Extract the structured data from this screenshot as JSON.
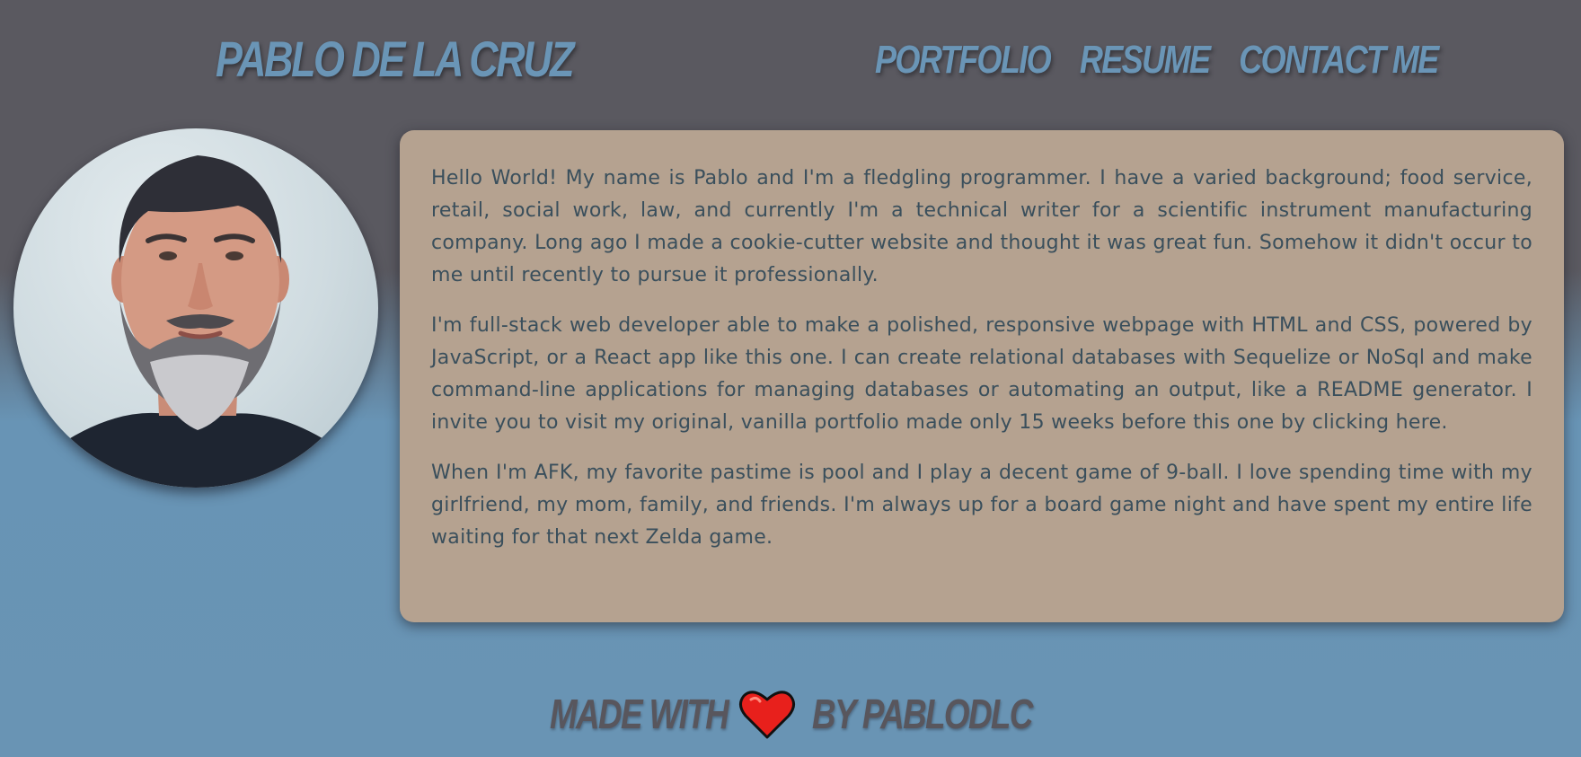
{
  "header": {
    "brand": "Pablo De La Cruz",
    "nav": [
      {
        "label": "Portfolio"
      },
      {
        "label": "Resume"
      },
      {
        "label": "Contact Me"
      }
    ]
  },
  "about": {
    "paragraphs": [
      "Hello World! My name is Pablo and I'm a fledgling programmer. I have a varied background; food service, retail, social work, law, and currently I'm a technical writer for a scientific instrument manufacturing company. Long ago I made a cookie-cutter website and thought it was great fun. Somehow it didn't occur to me until recently to pursue it professionally.",
      "I'm full-stack web developer able to make a polished, responsive webpage with HTML and CSS, powered by JavaScript, or a React app like this one. I can create relational databases with Sequelize or NoSql and make command-line applications for managing databases or automating an output, like a README generator. I invite you to visit my original, vanilla portfolio made only 15 weeks before this one by clicking here.",
      "When I'm AFK, my favorite pastime is pool and I play a decent game of 9-ball. I love spending time with my girlfriend, my mom, family, and friends. I'm always up for a board game night and have spent my entire life waiting for that next Zelda game."
    ]
  },
  "footer": {
    "made_with": "Made With",
    "by": "By PabloDLC",
    "icon": "heart-icon"
  },
  "colors": {
    "background_top": "#5a5960",
    "background_bottom": "#6994b4",
    "heading_blue": "#6a95b6",
    "card": "#b5a290",
    "body_text": "#3a4f5c",
    "footer_text": "#58565d",
    "heart": "#e8201c"
  }
}
